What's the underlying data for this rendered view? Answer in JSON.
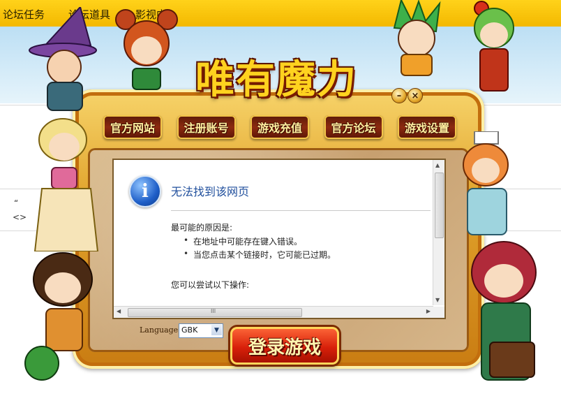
{
  "forum": {
    "nav_items": [
      "论坛任务",
      "论坛道具",
      "影视中心"
    ],
    "editor_glyphs": [
      "“",
      "<>"
    ]
  },
  "launcher": {
    "logo_text": "唯有魔力",
    "minimize_label": "–",
    "close_label": "×",
    "nav_buttons": [
      "官方网站",
      "注册账号",
      "游戏充值",
      "官方论坛",
      "游戏设置"
    ],
    "error_page": {
      "title": "无法找到该网页",
      "cause_heading": "最可能的原因是:",
      "causes": [
        "在地址中可能存在键入错误。",
        "当您点击某个链接时，它可能已过期。"
      ],
      "try_heading": "您可以尝试以下操作:",
      "hscroll_grip": "III"
    },
    "language_label": "Language:",
    "language_value": "GBK",
    "login_label": "登录游戏"
  },
  "colors": {
    "forum_bar": "#f3b800",
    "frame_gold": "#e0a22b",
    "nav_button": "#8c2a10",
    "nav_text": "#fff0a0",
    "login_red": "#d8200a",
    "error_title_blue": "#1f4e9c"
  },
  "icons": [
    "info-icon",
    "chevron-down-icon",
    "scroll-up-arrow-icon",
    "scroll-down-arrow-icon",
    "scroll-left-arrow-icon",
    "scroll-right-arrow-icon"
  ]
}
